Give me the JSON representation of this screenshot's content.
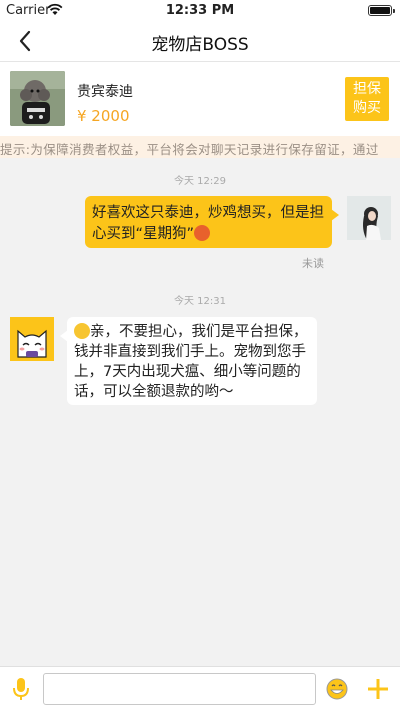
{
  "status_bar": {
    "carrier": "Carrier",
    "time": "12:33 PM"
  },
  "nav": {
    "title": "宠物店BOSS"
  },
  "product": {
    "name": "贵宾泰迪",
    "price": "¥ 2000",
    "escrow_line1": "担保",
    "escrow_line2": "购买"
  },
  "notice": {
    "text": "提示:为保障消费者权益，平台将会对聊天记录进行保存留证，通过"
  },
  "messages": [
    {
      "timestamp": "今天 12:29",
      "sender": "user",
      "text": "好喜欢这只泰迪，炒鸡想买，但是担心买到“星期狗”",
      "status": "未读"
    },
    {
      "timestamp": "今天 12:31",
      "sender": "shop",
      "text": "亲，不要担心，我们是平台担保，钱并非直接到我们手上。宠物到您手上，7天内出现犬瘟、细小等问题的话，可以全额退款的哟～"
    }
  ],
  "input": {
    "placeholder": ""
  },
  "colors": {
    "accent": "#fcc419",
    "price": "#f5a623",
    "notice_bg": "#fdf1e4"
  }
}
